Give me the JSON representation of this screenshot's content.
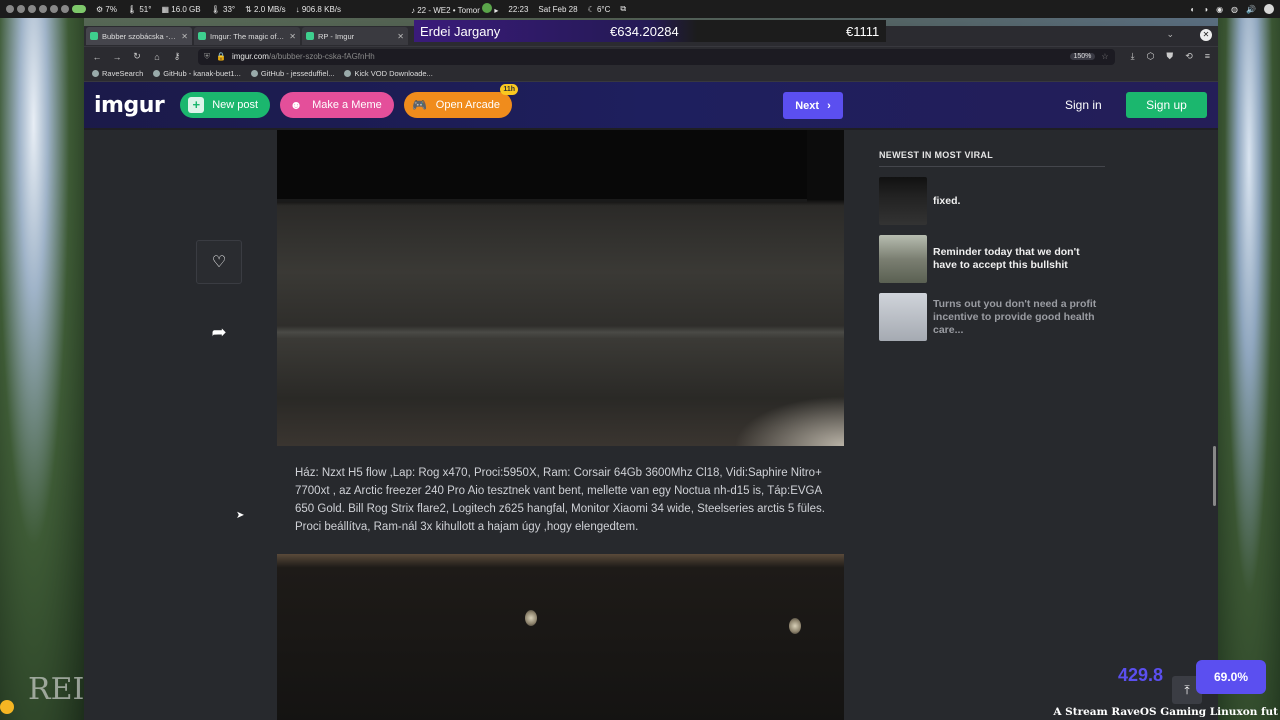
{
  "sysbar": {
    "cpu": "7%",
    "temp1": "51°",
    "mem": "16.0 GB",
    "temp2": "33°",
    "net_up": "2.0 MB/s",
    "net_down": "906.8 KB/s",
    "media": "22 - WE2 • Tomor",
    "time": "22:23",
    "date": "Sat Feb 28",
    "weather": "6°C"
  },
  "overlay": {
    "name": "Erdei Jargany",
    "amount1": "€634.20284",
    "amount2": "€1111"
  },
  "tabs": [
    {
      "title": "Bubber szobácska - Imgur",
      "active": true
    },
    {
      "title": "Imgur: The magic of the Int",
      "active": false
    },
    {
      "title": "RP - Imgur",
      "active": false
    }
  ],
  "url": {
    "host": "imgur.com",
    "path": "/a/bubber-szob-cska-fAGfnHh",
    "zoom": "150%"
  },
  "bookmarks": [
    "RaveSearch",
    "GitHub - kanak-buet1...",
    "GitHub - jesseduffiel...",
    "Kick VOD Downloade..."
  ],
  "header": {
    "logo": "imgur",
    "new_post": "New post",
    "make_meme": "Make a Meme",
    "open_arcade": "Open Arcade",
    "arcade_badge": "11h",
    "next": "Next",
    "sign_in": "Sign in",
    "sign_up": "Sign up"
  },
  "post": {
    "description": "Ház: Nzxt H5 flow ,Lap: Rog x470, Proci:5950X, Ram: Corsair 64Gb 3600Mhz Cl18, Vidi:Saphire Nitro+ 7700xt , az Arctic freezer 240 Pro Aio tesztnek vant bent, mellette van egy Noctua nh-d15 is, Táp:EVGA 650 Gold. Bill Rog Strix flare2, Logitech z625 hangfal, Monitor Xiaomi 34 wide, Steelseries arctis 5 füles. Proci beállítva, Ram-nál 3x kihullott a hajam úgy ,hogy elengedtem."
  },
  "sidebar": {
    "title": "NEWEST IN MOST VIRAL",
    "items": [
      {
        "text": "fixed."
      },
      {
        "text": "Reminder today that we don't have to accept this bullshit"
      },
      {
        "text": "Turns out you don't need a profit incentive to provide good health care..."
      }
    ]
  },
  "stream": {
    "big_stat": "429.8",
    "pill_stat": "69.0%",
    "ticker": "A Stream RaveOS Gaming Linuxon fut",
    "rei": "REI"
  }
}
